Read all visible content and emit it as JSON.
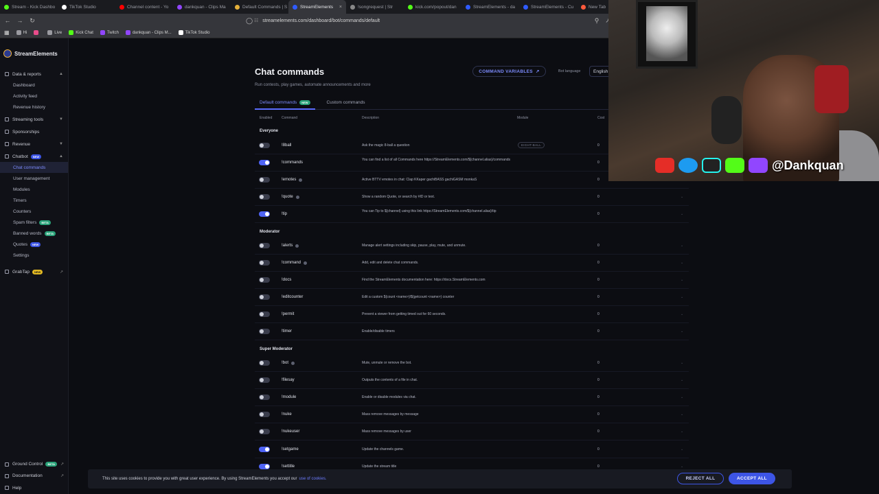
{
  "browser": {
    "tabs": [
      {
        "label": "Stream - Kick Dashbo",
        "color": "#53fc18"
      },
      {
        "label": "TikTok Studio",
        "color": "#ffffff"
      },
      {
        "label": "Channel content - Yo",
        "color": "#ff0000"
      },
      {
        "label": "dankquan - Clips Ma",
        "color": "#9146ff"
      },
      {
        "label": "Default Commands | S",
        "color": "#e5b13a"
      },
      {
        "label": "StreamElements",
        "color": "#2f5bff",
        "active": true
      },
      {
        "label": "!songrequest | Str",
        "color": "#888888"
      },
      {
        "label": "kick.com/popout/dan",
        "color": "#53fc18"
      },
      {
        "label": "StreamElements - da",
        "color": "#2f5bff"
      },
      {
        "label": "StreamElements - Cu",
        "color": "#2f5bff"
      },
      {
        "label": "New Tab",
        "color": "#ff5a3c"
      }
    ],
    "url": "streamelements.com/dashboard/bot/commands/default",
    "bookmarks": [
      {
        "label": "Hi",
        "color": "#9a9aa0"
      },
      {
        "label": "",
        "color": "#e84c8a"
      },
      {
        "label": "Live",
        "color": "#9a9aa0"
      },
      {
        "label": "Kick Chat",
        "color": "#53fc18"
      },
      {
        "label": "Twitch",
        "color": "#9146ff"
      },
      {
        "label": "dankquan - Clips M...",
        "color": "#9146ff"
      },
      {
        "label": "TikTok Studio",
        "color": "#ffffff"
      }
    ]
  },
  "sidebar": {
    "brand": "StreamElements",
    "data_reports": "Data & reports",
    "data_items": [
      "Dashboard",
      "Activity feed",
      "Revenue history"
    ],
    "streaming_tools": "Streaming tools",
    "sponsorships": "Sponsorships",
    "revenue": "Revenue",
    "chatbot": "Chatbot",
    "chatbot_badge": "NEW",
    "chatbot_items": [
      {
        "label": "Chat commands",
        "active": true
      },
      {
        "label": "User management"
      },
      {
        "label": "Modules"
      },
      {
        "label": "Timers"
      },
      {
        "label": "Counters"
      },
      {
        "label": "Spam filters",
        "badge": "BETA"
      },
      {
        "label": "Banned words",
        "badge": "BETA"
      },
      {
        "label": "Quotes",
        "badge": "NEW"
      },
      {
        "label": "Settings"
      }
    ],
    "grabtap": "GrabTap",
    "grabtap_badge": "NEW",
    "ground_control": "Ground Control",
    "ground_control_badge": "BETA",
    "documentation": "Documentation",
    "help": "Help"
  },
  "page": {
    "title": "Chat commands",
    "subtitle": "Run contests, play games, automate announcements and more",
    "command_variables": "COMMAND VARIABLES",
    "bot_language_label": "Bot language",
    "bot_language": "English",
    "tab_default": "Default commands",
    "tab_default_badge": "NEW",
    "tab_custom": "Custom commands",
    "col_enabled": "Enabled",
    "col_command": "Command",
    "col_description": "Description",
    "col_module": "Module",
    "col_cost": "Cost"
  },
  "groups": {
    "everyone": "Everyone",
    "moderator": "Moderator",
    "super_moderator": "Super Moderator"
  },
  "commands": [
    {
      "name": "!8ball",
      "on": false,
      "desc": "Ask the magic 8-ball a question",
      "module": "EIGHT-BALL",
      "cost": "0"
    },
    {
      "name": "!commands",
      "on": true,
      "desc": "You can find a list of all Commands here https://StreamElements.com/${channel.alias}/commands",
      "cost": "0"
    },
    {
      "name": "!emotes",
      "on": false,
      "info": true,
      "desc": "Active BTTV emotes in chat: Clap KKaper gachiBASS gachiGASM monkaS",
      "cost": "0"
    },
    {
      "name": "!quote",
      "on": false,
      "info": true,
      "desc": "Show a random Quote, or search by #ID or text.",
      "cost": "0"
    },
    {
      "name": "!tip",
      "on": true,
      "desc": "You can Tip to ${channel} using this link https://StreamElements.com/${channel.alias}/tip",
      "cost": "0"
    },
    {
      "name": "!alerts",
      "on": false,
      "info": true,
      "desc": "Manage alert settings including skip, pause, play, mute, and unmute.",
      "cost": "0"
    },
    {
      "name": "!command",
      "on": false,
      "info": true,
      "desc": "Add, edit and delete chat commands.",
      "cost": "0"
    },
    {
      "name": "!docs",
      "on": false,
      "desc": "Find the StreamElements documentation here: https://docs.StreamElements.com",
      "cost": "0"
    },
    {
      "name": "!editcounter",
      "on": false,
      "desc": "Edit a custom ${count <name>}/${getcount <name>} counter",
      "cost": "0"
    },
    {
      "name": "!permit",
      "on": false,
      "desc": "Prevent a viewer from getting timed out for 60 seconds.",
      "cost": "0"
    },
    {
      "name": "!timer",
      "on": false,
      "desc": "Enable/disable timers",
      "cost": "0"
    },
    {
      "name": "!bot",
      "on": false,
      "info": true,
      "desc": "Mute, unmute or remove the bot.",
      "cost": "0"
    },
    {
      "name": "!filesay",
      "on": false,
      "desc": "Outputs the contents of a file in chat.",
      "cost": "0"
    },
    {
      "name": "!module",
      "on": false,
      "desc": "Enable or disable modules via chat.",
      "cost": "0"
    },
    {
      "name": "!nuke",
      "on": false,
      "desc": "Mass remove messages by message",
      "cost": "0"
    },
    {
      "name": "!nukeuser",
      "on": false,
      "desc": "Mass remove messages by user",
      "cost": "0"
    },
    {
      "name": "!setgame",
      "on": true,
      "desc": "Update the channels game.",
      "cost": "0"
    },
    {
      "name": "!settitle",
      "on": true,
      "desc": "Update the stream title",
      "cost": "0"
    }
  ],
  "overlay": {
    "handle": "@Dankquan"
  },
  "cookie": {
    "text": "This site uses cookies to provide you with great user experience. By using StreamElements you accept our",
    "link": "use of cookies.",
    "reject": "REJECT ALL",
    "accept": "ACCEPT ALL"
  }
}
